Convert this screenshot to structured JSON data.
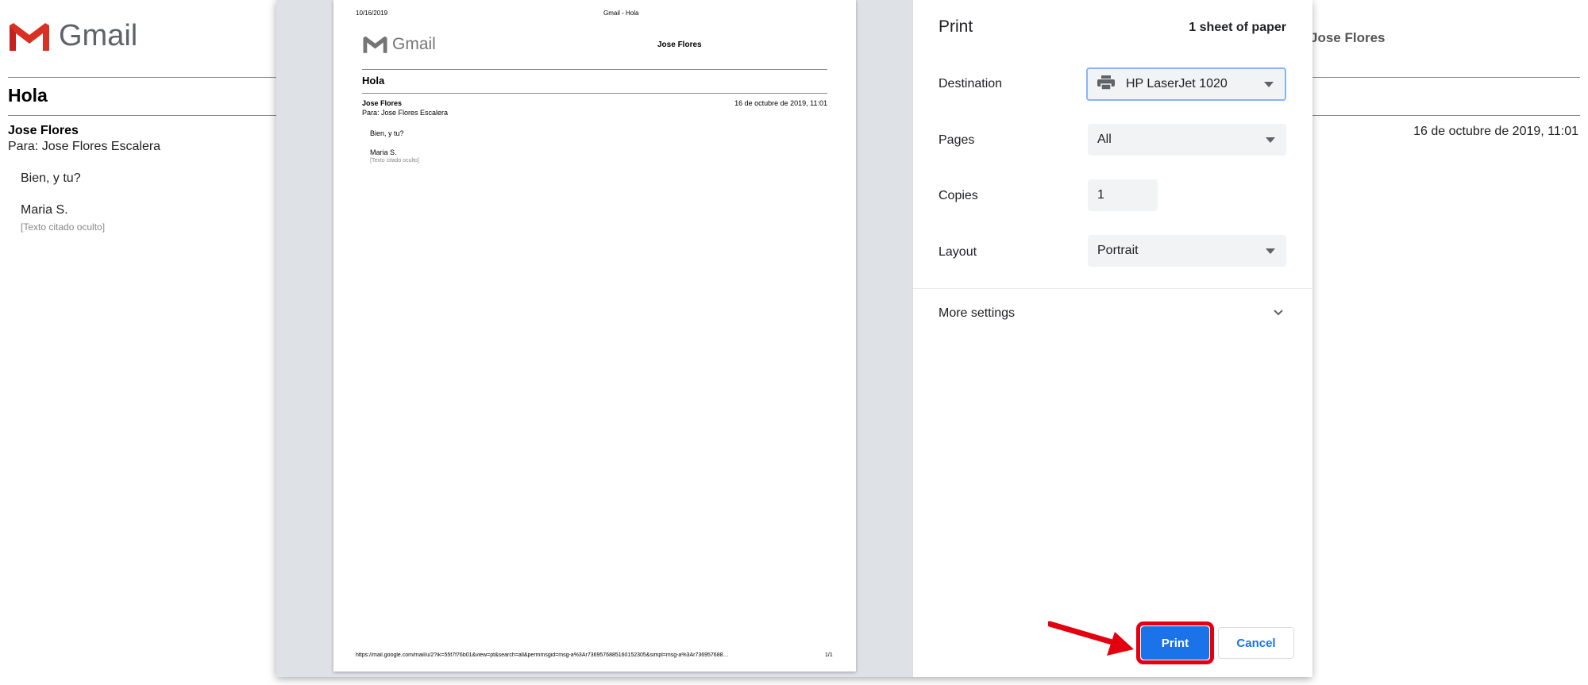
{
  "background": {
    "brand": "Gmail",
    "subject": "Hola",
    "sender": "Jose Flores",
    "recipient": "Para: Jose Flores Escalera",
    "date": "16 de octubre de 2019, 11:01",
    "body_line1": "Bien, y tu?",
    "body_line2": "Maria S.",
    "quoted_text": "[Texto citado oculto]",
    "username": "Jose Flores"
  },
  "preview": {
    "header_date": "10/16/2019",
    "header_title": "Gmail - Hola",
    "brand": "Gmail",
    "account_name": "Jose Flores",
    "subject": "Hola",
    "sender": "Jose Flores",
    "recipient": "Para: Jose Flores Escalera",
    "date": "16 de octubre de 2019, 11:01",
    "body_line1": "Bien, y tu?",
    "body_line2": "Maria S.",
    "quoted_text": "[Texto citado oculto]",
    "footer_url": "https://mail.google.com/mail/u/2?ik=55f7f76b01&view=pt&search=all&permmsgid=msg-a%3Ar7369576885160152305&simpl=msg-a%3Ar736957688…",
    "page_number": "1/1"
  },
  "print_settings": {
    "title": "Print",
    "sheet_count": "1 sheet of paper",
    "destination_label": "Destination",
    "destination_value": "HP LaserJet 1020",
    "pages_label": "Pages",
    "pages_value": "All",
    "copies_label": "Copies",
    "copies_value": "1",
    "layout_label": "Layout",
    "layout_value": "Portrait",
    "more_settings_label": "More settings",
    "print_button": "Print",
    "cancel_button": "Cancel"
  },
  "colors": {
    "primary": "#1a73e8",
    "highlight": "#e3000f",
    "gmail_red": "#d93025"
  }
}
